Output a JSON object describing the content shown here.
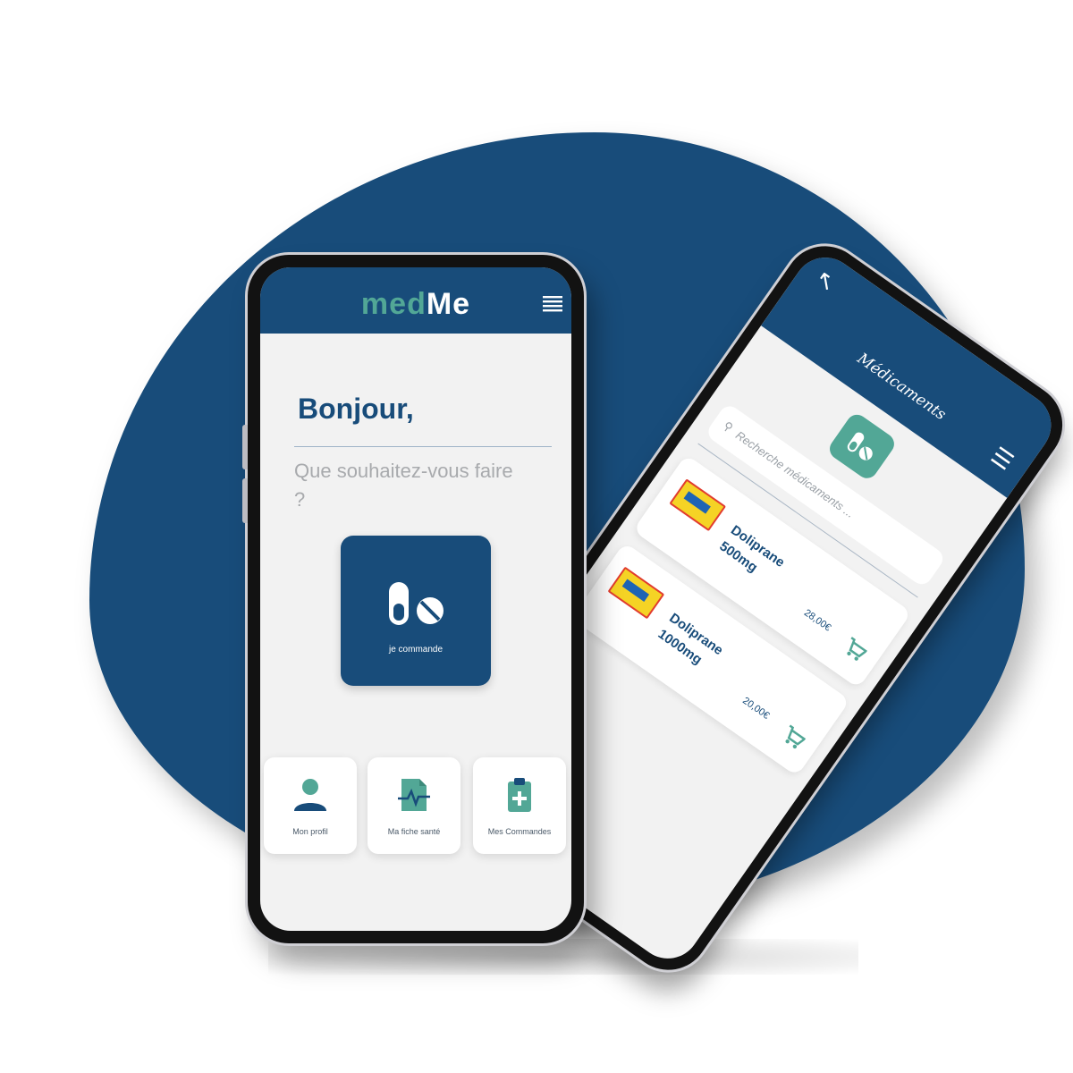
{
  "colors": {
    "brand_blue": "#184c7a",
    "accent_green": "#52a796",
    "background": "#f2f2f2"
  },
  "home": {
    "logo_part1": "med",
    "logo_part2": "Me",
    "greeting": "Bonjour,",
    "subtitle": "Que souhaitez-vous faire ?",
    "order_label": "je commande",
    "tiles": [
      {
        "label": "Mon profil",
        "icon": "user-icon"
      },
      {
        "label": "Ma fiche santé",
        "icon": "health-file-icon"
      },
      {
        "label": "Mes Commandes",
        "icon": "orders-clipboard-icon"
      }
    ]
  },
  "medications": {
    "title": "Médicaments",
    "search_placeholder": "Recherche médicaments ...",
    "items": [
      {
        "name": "Doliprane 500mg",
        "price": "28,00€"
      },
      {
        "name": "Doliprane 1000mg",
        "price": "20,00€"
      }
    ]
  }
}
